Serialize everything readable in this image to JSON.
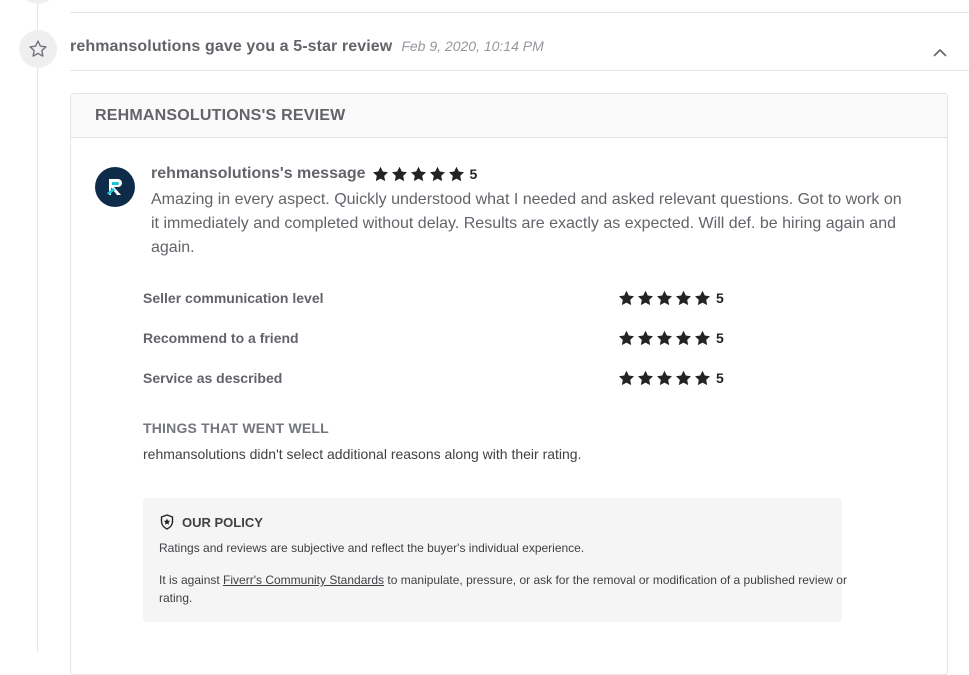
{
  "event": {
    "title": "rehmansolutions gave you a 5-star review",
    "date": "Feb 9, 2020, 10:14 PM",
    "icon": "star-outline-icon",
    "toggle_icon": "chevron-up-icon"
  },
  "review": {
    "card_title": "REHMANSOLUTIONS'S REVIEW",
    "avatar_icon": "brand-logo-icon",
    "message_title": "rehmansolutions's message",
    "overall_score": "5",
    "overall_stars": 5,
    "message_text": "Amazing in every aspect. Quickly understood what I needed and asked relevant questions. Got to work on it immediately and completed without delay. Results are exactly as expected. Will def. be hiring again and again.",
    "ratings": [
      {
        "label": "Seller communication level",
        "score": "5",
        "stars": 5
      },
      {
        "label": "Recommend to a friend",
        "score": "5",
        "stars": 5
      },
      {
        "label": "Service as described",
        "score": "5",
        "stars": 5
      }
    ],
    "went_well_title": "THINGS THAT WENT WELL",
    "went_well_text": "rehmansolutions didn't select additional reasons along with their rating."
  },
  "policy": {
    "icon": "shield-star-icon",
    "title": "OUR POLICY",
    "line1": "Ratings and reviews are subjective and reflect the buyer's individual experience.",
    "line2_prefix": "It is against ",
    "line2_link": "Fiverr's Community Standards",
    "line2_suffix": " to manipulate, pressure, or ask for the removal or modification of a published review or rating."
  },
  "colors": {
    "star": "#222325",
    "avatar_bg": "#0f2b4a",
    "muted_text": "#62646a",
    "date_text": "#95979d"
  }
}
